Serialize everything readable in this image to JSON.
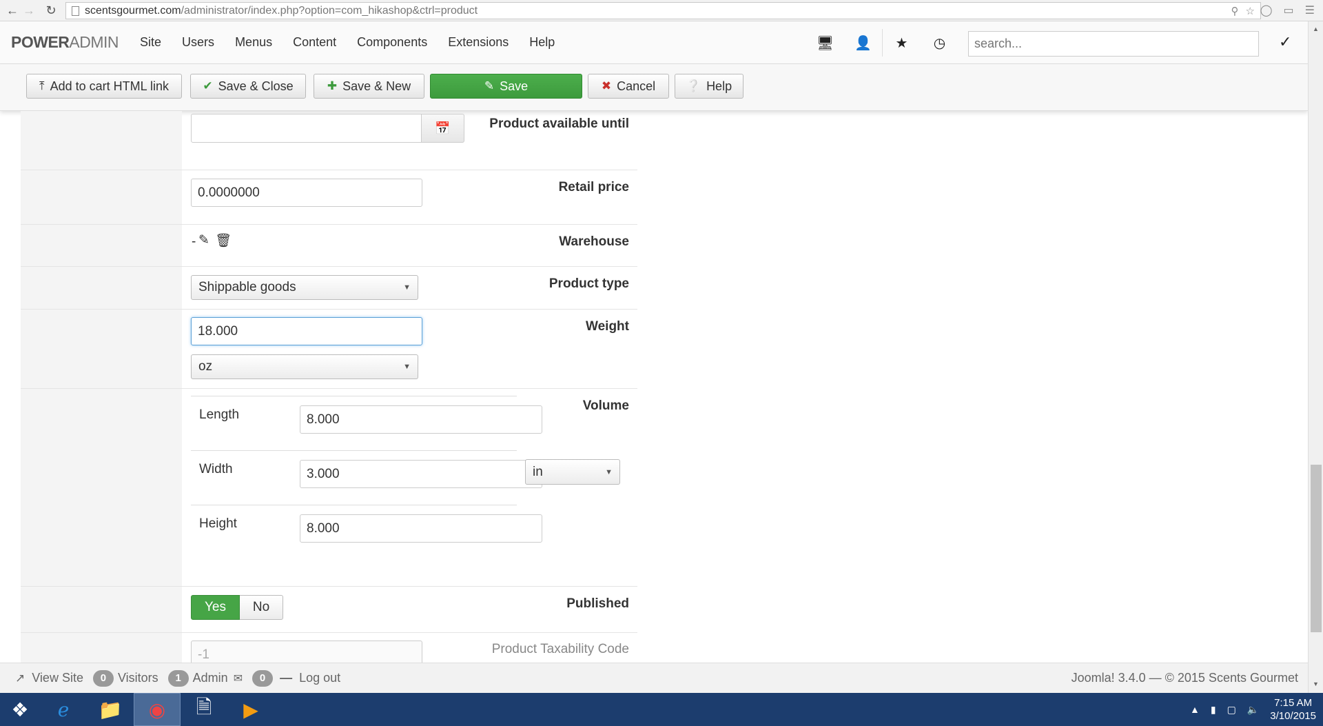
{
  "browser": {
    "url_host": "scentsgourmet.com",
    "url_path": "/administrator/index.php?option=com_hikashop&ctrl=product"
  },
  "admin_nav": {
    "brand_bold": "POWER",
    "brand_light": "ADMIN",
    "menu": [
      "Site",
      "Users",
      "Menus",
      "Content",
      "Components",
      "Extensions",
      "Help"
    ],
    "search_placeholder": "search..."
  },
  "toolbar": {
    "add_to_cart": "Add to cart HTML link",
    "save_close": "Save & Close",
    "save_new": "Save & New",
    "save": "Save",
    "cancel": "Cancel",
    "help": "Help"
  },
  "form": {
    "available_until_label": "Product available until",
    "available_until_value": "",
    "retail_price_label": "Retail price",
    "retail_price_value": "0.0000000",
    "warehouse_label": "Warehouse",
    "warehouse_value": "-",
    "product_type_label": "Product type",
    "product_type_value": "Shippable goods",
    "weight_label": "Weight",
    "weight_value": "18.000",
    "weight_unit": "oz",
    "volume_label": "Volume",
    "length_label": "Length",
    "length_value": "8.000",
    "width_label": "Width",
    "width_value": "3.000",
    "height_label": "Height",
    "height_value": "8.000",
    "dimension_unit": "in",
    "published_label": "Published",
    "published_yes": "Yes",
    "published_no": "No",
    "taxability_label": "Product Taxability Code",
    "taxability_value": "-1"
  },
  "status_bar": {
    "view_site": "View Site",
    "visitors_count": "0",
    "visitors_label": "Visitors",
    "admin_count": "1",
    "admin_label": "Admin",
    "messages_count": "0",
    "logout": "Log out",
    "right_text": "Joomla! 3.4.0  —  © 2015 Scents Gourmet"
  },
  "taskbar": {
    "time": "7:15 AM",
    "date": "3/10/2015"
  },
  "colors": {
    "save_green": "#46a546",
    "taskbar_blue": "#1c3d6e"
  }
}
